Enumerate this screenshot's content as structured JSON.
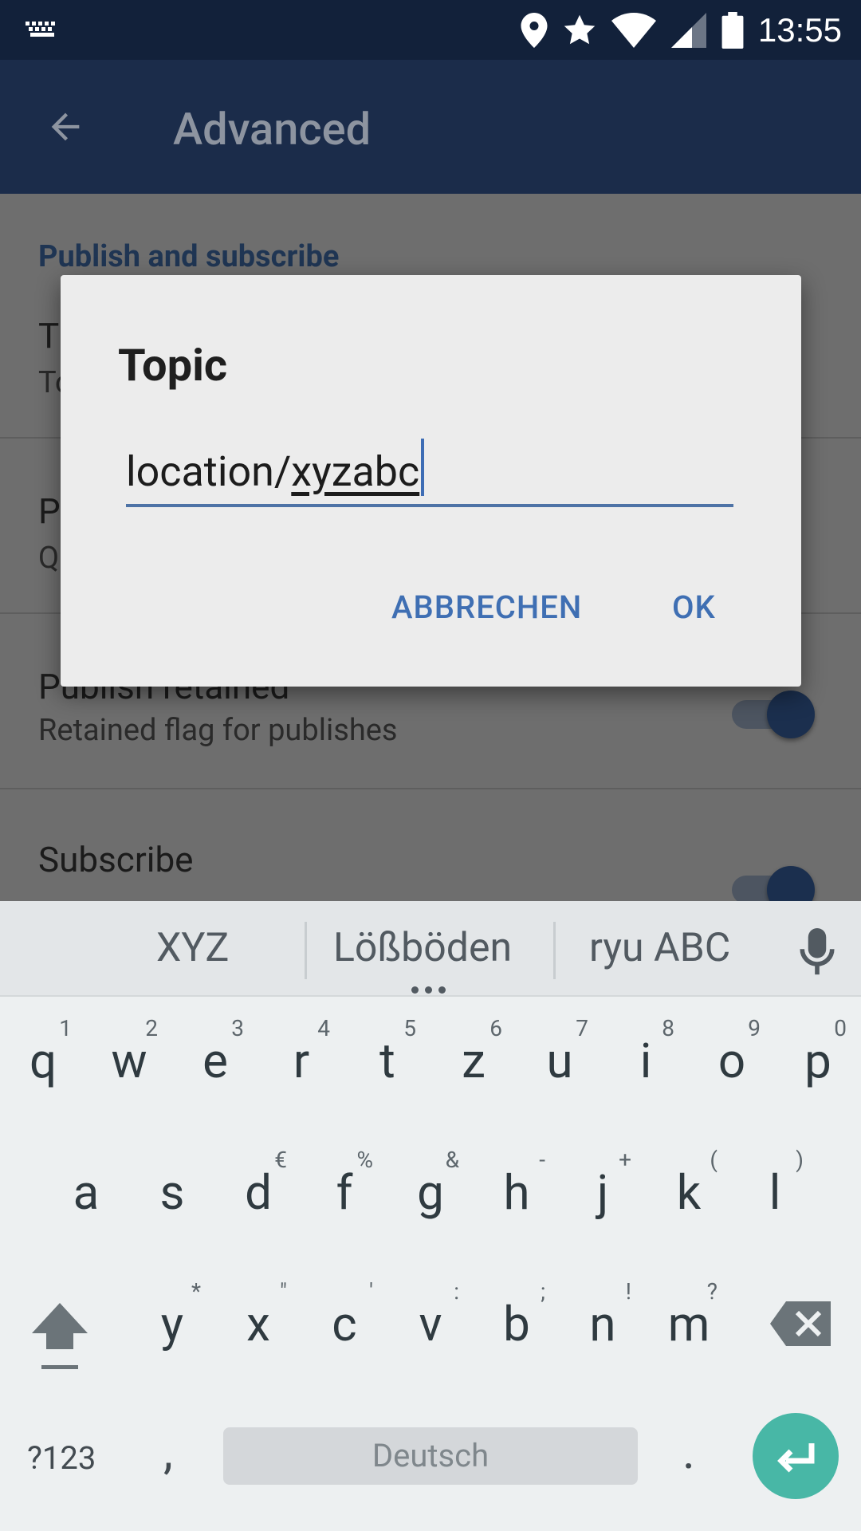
{
  "status_bar": {
    "time": "13:55",
    "icons": [
      "keyboard-icon",
      "location-icon",
      "star-icon",
      "wifi-icon",
      "signal-icon",
      "battery-icon"
    ]
  },
  "app_bar": {
    "title": "Advanced",
    "back_icon": "arrow-back-icon"
  },
  "settings": {
    "category": "Publish and subscribe",
    "items": [
      {
        "title": "T",
        "summary": "To"
      },
      {
        "title": "P",
        "summary": "Q"
      },
      {
        "title": "Publish retained",
        "summary": "Retained flag for publishes",
        "toggle_on": true
      },
      {
        "title": "Subscribe",
        "summary": "",
        "toggle_on": true
      }
    ]
  },
  "dialog": {
    "title": "Topic",
    "input_prefix": "location/",
    "input_composing": "xyzabc",
    "cancel_label": "ABBRECHEN",
    "ok_label": "OK"
  },
  "keyboard": {
    "suggestions": [
      "XYZ",
      "Lößböden",
      "ryu ABC"
    ],
    "rows": [
      [
        [
          "q",
          "1"
        ],
        [
          "w",
          "2"
        ],
        [
          "e",
          "3"
        ],
        [
          "r",
          "4"
        ],
        [
          "t",
          "5"
        ],
        [
          "z",
          "6"
        ],
        [
          "u",
          "7"
        ],
        [
          "i",
          "8"
        ],
        [
          "o",
          "9"
        ],
        [
          "p",
          "0"
        ]
      ],
      [
        [
          "a",
          ""
        ],
        [
          "s",
          ""
        ],
        [
          "d",
          "€"
        ],
        [
          "f",
          "%"
        ],
        [
          "g",
          "&"
        ],
        [
          "h",
          "-"
        ],
        [
          "j",
          "+"
        ],
        [
          "k",
          "("
        ],
        [
          "l",
          ")"
        ]
      ],
      [
        [
          "y",
          "*"
        ],
        [
          "x",
          "\""
        ],
        [
          "c",
          "'"
        ],
        [
          "v",
          ":"
        ],
        [
          "b",
          ";"
        ],
        [
          "n",
          "!"
        ],
        [
          "m",
          "?"
        ]
      ]
    ],
    "symbols_label": "?123",
    "comma_label": ",",
    "space_label": "Deutsch",
    "period_label": ".",
    "colors": {
      "enter": "#48b7a6",
      "accent": "#3f6fb3"
    }
  }
}
